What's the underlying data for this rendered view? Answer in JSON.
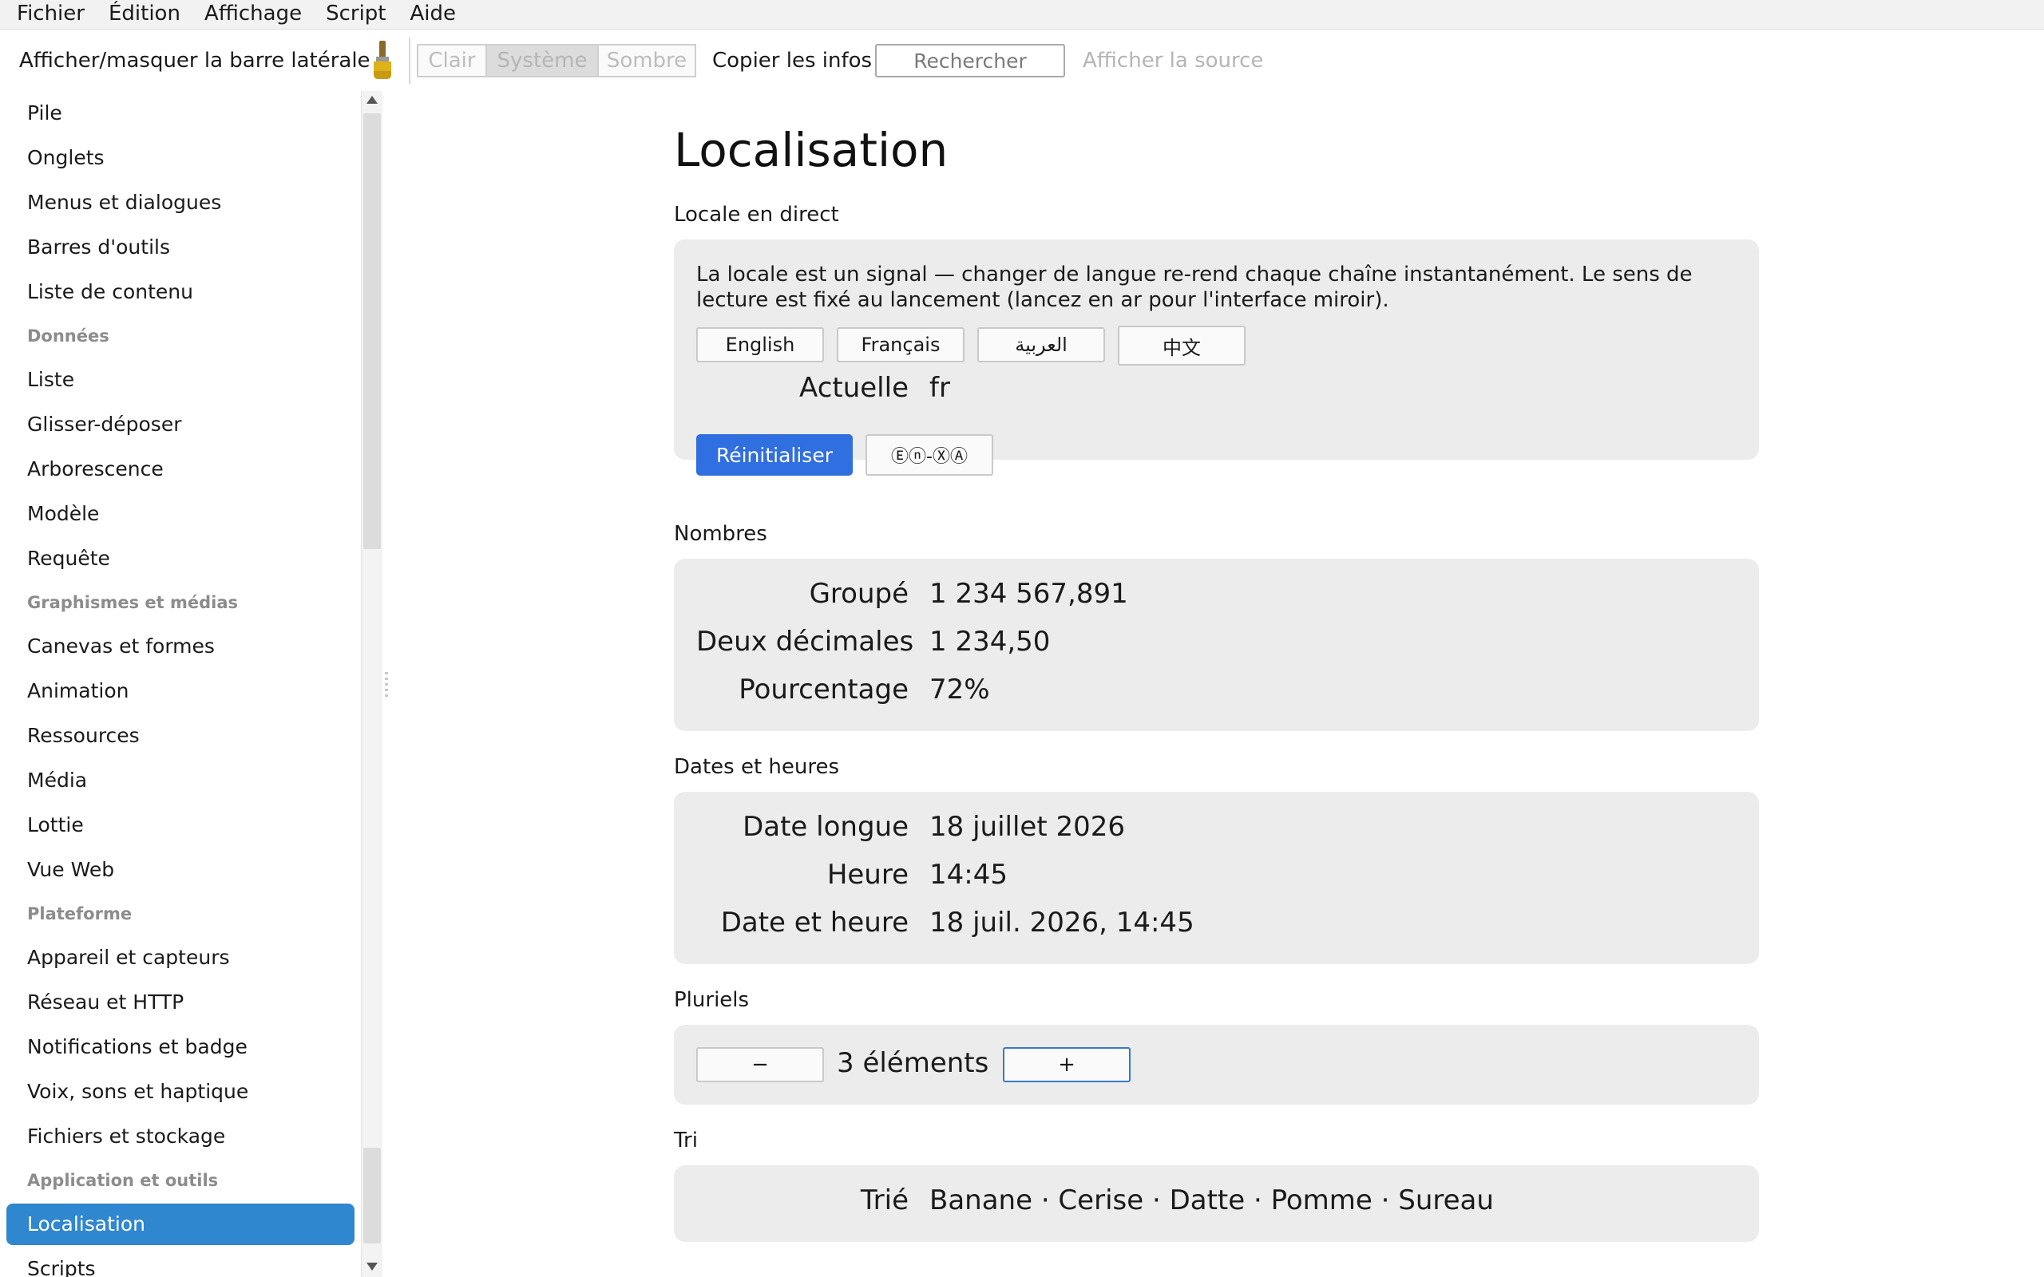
{
  "menu": [
    "Fichier",
    "Édition",
    "Affichage",
    "Script",
    "Aide"
  ],
  "toolbar": {
    "toggle_sidebar": "Afficher/masquer la barre latérale",
    "theme_options": [
      "Clair",
      "Système",
      "Sombre"
    ],
    "theme_selected": "Système",
    "copy_info": "Copier les infos",
    "search_placeholder": "Rechercher",
    "view_source": "Afficher la source"
  },
  "sidebar": {
    "items": [
      {
        "label": "Pile",
        "type": "item"
      },
      {
        "label": "Onglets",
        "type": "item"
      },
      {
        "label": "Menus et dialogues",
        "type": "item"
      },
      {
        "label": "Barres d'outils",
        "type": "item"
      },
      {
        "label": "Liste de contenu",
        "type": "item"
      },
      {
        "label": "Données",
        "type": "section"
      },
      {
        "label": "Liste",
        "type": "item"
      },
      {
        "label": "Glisser-déposer",
        "type": "item"
      },
      {
        "label": "Arborescence",
        "type": "item"
      },
      {
        "label": "Modèle",
        "type": "item"
      },
      {
        "label": "Requête",
        "type": "item"
      },
      {
        "label": "Graphismes et médias",
        "type": "section"
      },
      {
        "label": "Canevas et formes",
        "type": "item"
      },
      {
        "label": "Animation",
        "type": "item"
      },
      {
        "label": "Ressources",
        "type": "item"
      },
      {
        "label": "Média",
        "type": "item"
      },
      {
        "label": "Lottie",
        "type": "item"
      },
      {
        "label": "Vue Web",
        "type": "item"
      },
      {
        "label": "Plateforme",
        "type": "section"
      },
      {
        "label": "Appareil et capteurs",
        "type": "item"
      },
      {
        "label": "Réseau et HTTP",
        "type": "item"
      },
      {
        "label": "Notifications et badge",
        "type": "item"
      },
      {
        "label": "Voix, sons et haptique",
        "type": "item"
      },
      {
        "label": "Fichiers et stockage",
        "type": "item"
      },
      {
        "label": "Application et outils",
        "type": "section"
      },
      {
        "label": "Localisation",
        "type": "item",
        "selected": true
      },
      {
        "label": "Scripts",
        "type": "item"
      }
    ]
  },
  "main": {
    "title": "Localisation",
    "live_locale": {
      "heading": "Locale en direct",
      "description": "La locale est un signal — changer de langue re-rend chaque chaîne instantanément. Le sens de lecture est fixé au lancement (lancez en ar pour l'interface miroir).",
      "languages": [
        "English",
        "Français",
        "العربية",
        "中文"
      ],
      "current_label": "Actuelle",
      "current_value": "fr",
      "reset": "Réinitialiser",
      "pseudo": "Ⓔⓝ-ⓍⒶ"
    },
    "numbers": {
      "heading": "Nombres",
      "rows": [
        {
          "label": "Groupé",
          "value": "1 234 567,891"
        },
        {
          "label": "Deux décimales",
          "value": "1 234,50"
        },
        {
          "label": "Pourcentage",
          "value": "72%"
        }
      ]
    },
    "dates": {
      "heading": "Dates et heures",
      "rows": [
        {
          "label": "Date longue",
          "value": "18 juillet 2026"
        },
        {
          "label": "Heure",
          "value": "14:45"
        },
        {
          "label": "Date et heure",
          "value": "18 juil. 2026, 14:45"
        }
      ]
    },
    "plurals": {
      "heading": "Pluriels",
      "minus": "−",
      "count": "3 éléments",
      "plus": "+"
    },
    "sort": {
      "heading": "Tri",
      "label": "Trié",
      "value": "Banane · Cerise · Datte · Pomme · Sureau"
    }
  },
  "colors": {
    "accent": "#2f6fdf",
    "selected_nav": "#2f87cf",
    "card_bg": "#ececec"
  }
}
